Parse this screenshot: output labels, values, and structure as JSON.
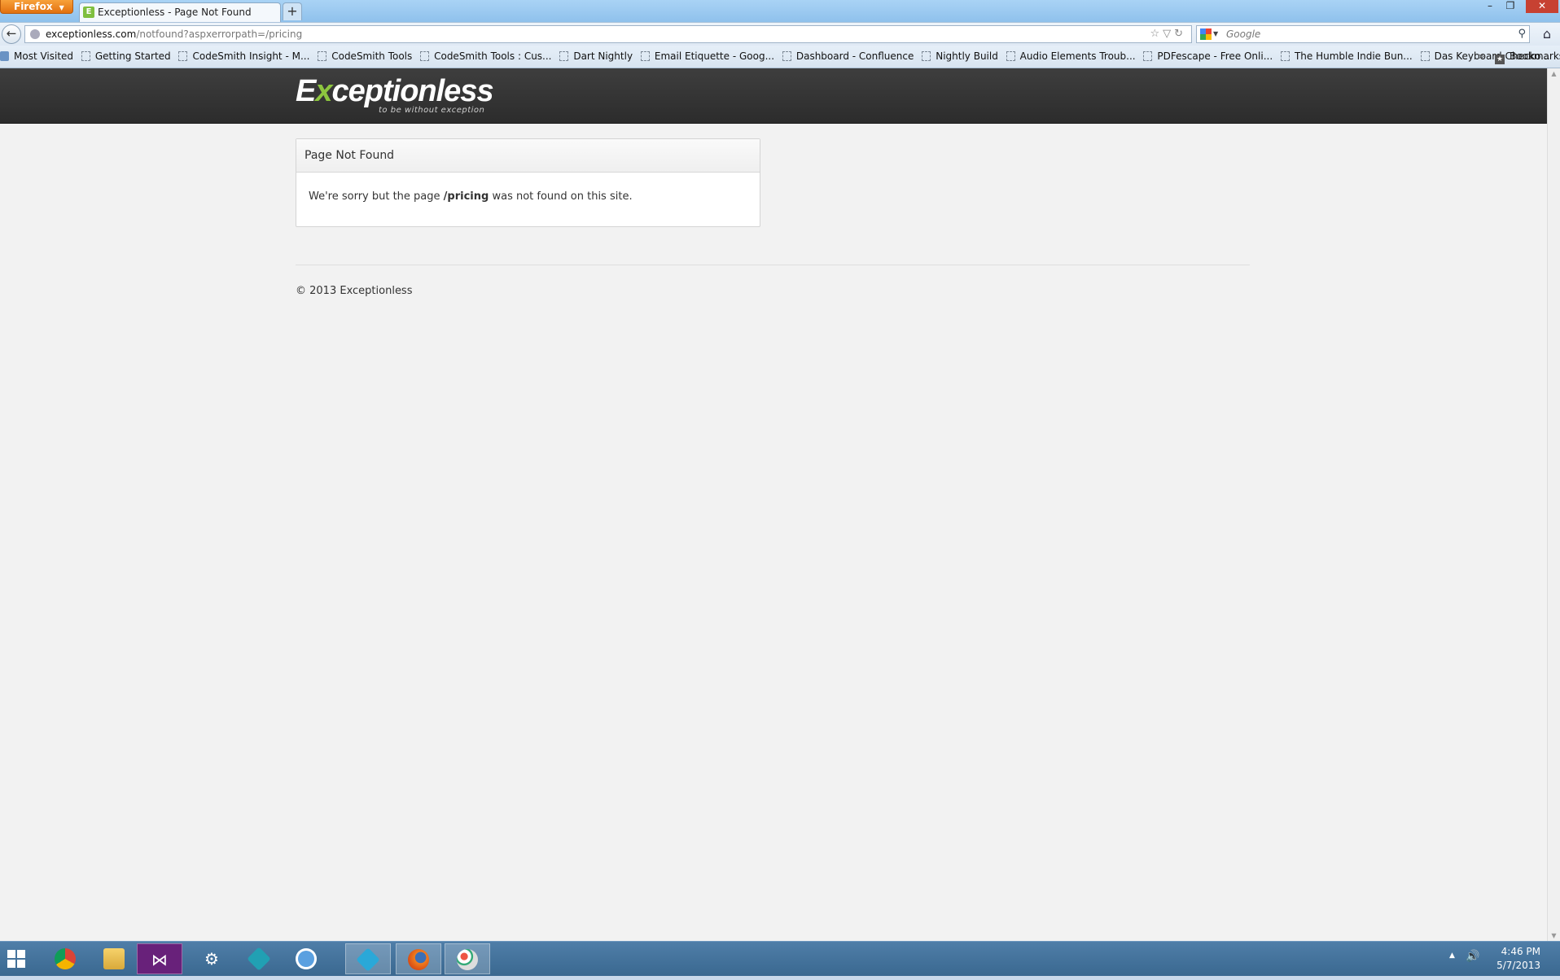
{
  "browser": {
    "menu_button": "Firefox",
    "tab": {
      "title": "Exceptionless - Page Not Found",
      "favicon": "E"
    },
    "new_tab": "+",
    "url": {
      "host": "exceptionless.com",
      "path": "/notfound?aspxerrorpath=/pricing"
    },
    "search": {
      "placeholder": "Google"
    },
    "bookmarks": [
      "Most Visited",
      "Getting Started",
      "CodeSmith Insight - M...",
      "CodeSmith Tools",
      "CodeSmith Tools : Cus...",
      "Dart Nightly",
      "Email Etiquette - Goog...",
      "Dashboard - Confluence",
      "Nightly Build",
      "Audio Elements Troub...",
      "PDFescape - Free Onli...",
      "The Humble Indie Bun...",
      "Das Keyboard Checko..."
    ],
    "bookmarks_menu": "Bookmarks"
  },
  "site": {
    "logo": {
      "prefix": "E",
      "accent": "x",
      "rest": "ceptionless",
      "tagline": "to be without exception"
    },
    "panel": {
      "heading": "Page Not Found",
      "message_before": "We're sorry but the page",
      "path": "/pricing",
      "message_after": "was not found on this site."
    },
    "footer": "© 2013 Exceptionless"
  },
  "taskbar": {
    "apps": [
      "chrome-icon",
      "file-explorer-icon",
      "visual-studio-icon",
      "tortoise-icon",
      "app-icon",
      "chat-icon",
      "dart-editor-icon",
      "firefox-icon",
      "paint-icon"
    ],
    "clock": {
      "time": "4:46 PM",
      "date": "5/7/2013"
    }
  },
  "colors": {
    "brand_accent": "#8dc63f",
    "header_bg": "#333333",
    "page_bg": "#f2f2f2"
  }
}
